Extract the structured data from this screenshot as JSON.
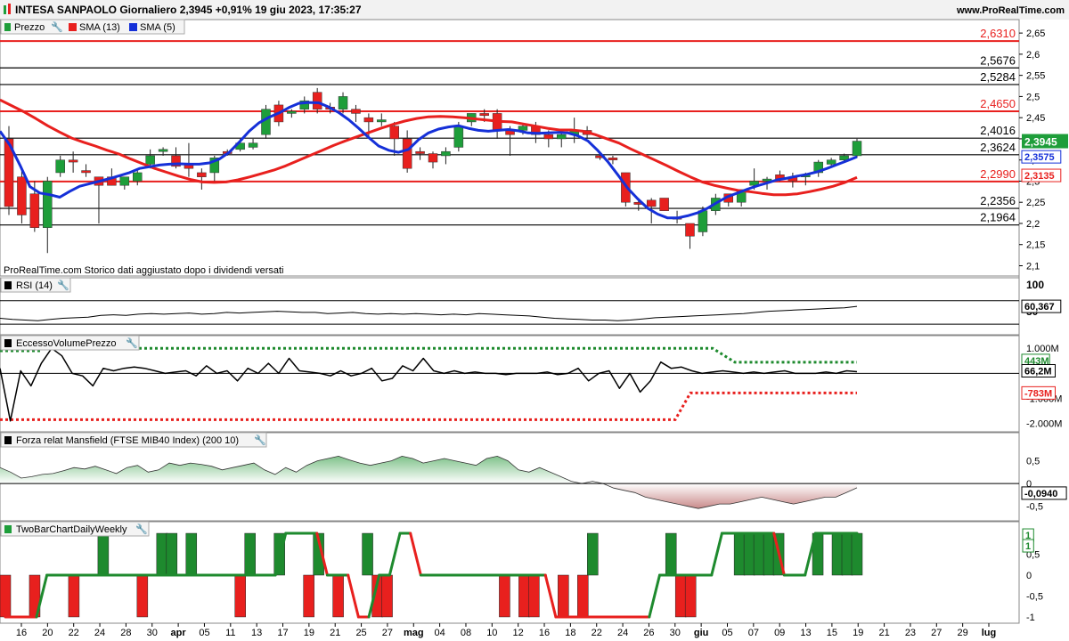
{
  "header": {
    "title": "INTESA SANPAOLO Giornaliero 2,3945 +0,91% 19 giu 2023, 17:35:27",
    "site": "www.ProRealTime.com"
  },
  "price_panel": {
    "legend": [
      {
        "label": "Prezzo",
        "color": "#1e9e3a"
      },
      {
        "label": "SMA (13)",
        "color": "#e8201e"
      },
      {
        "label": "SMA (5)",
        "color": "#1530d8"
      }
    ],
    "note": "ProRealTime.com  Storico dati aggiustato dopo i dividendi versati",
    "last_price_badge": "2,3945",
    "sma5_badge": "2,3575",
    "sma13_badge": "2,3135"
  },
  "rsi_panel": {
    "legend": "RSI (14)",
    "value_badge": "60,367",
    "ticks": [
      "100",
      "50"
    ]
  },
  "volume_panel": {
    "legend": "EccessoVolumePrezzo",
    "ticks": [
      "1.000M",
      "0",
      "-1.000M",
      "-2.000M"
    ],
    "badges": [
      "443M",
      "66,2M",
      "-783M"
    ]
  },
  "mansfield_panel": {
    "legend": "Forza relat Mansfield (FTSE MIB40 Index) (200 10)",
    "ticks": [
      "0,5",
      "0",
      "-0,5"
    ],
    "value_badge": "-0,0940"
  },
  "twobar_panel": {
    "legend": "TwoBarChartDailyWeekly",
    "ticks": [
      "1",
      "0,5",
      "0",
      "-0,5",
      "-1"
    ],
    "badges": [
      "1",
      "1"
    ]
  },
  "x_axis_labels": [
    "16",
    "20",
    "22",
    "24",
    "28",
    "30",
    "apr",
    "05",
    "11",
    "13",
    "17",
    "19",
    "21",
    "25",
    "27",
    "mag",
    "04",
    "08",
    "10",
    "12",
    "16",
    "18",
    "22",
    "24",
    "26",
    "30",
    "giu",
    "05",
    "07",
    "09",
    "13",
    "15",
    "19",
    "21",
    "23",
    "27",
    "29",
    "lug"
  ],
  "colors": {
    "up": "#1e9e3a",
    "down": "#e8201e",
    "sma13": "#e8201e",
    "sma5": "#1530d8",
    "grid": "#000000"
  },
  "chart_data": [
    {
      "type": "candlestick",
      "name": "Prezzo",
      "y_ticks": [
        "2,65",
        "2,6",
        "2,55",
        "2,5",
        "2,45",
        "2,4",
        "2,35",
        "2,3",
        "2,25",
        "2,2",
        "2,15",
        "2,1"
      ],
      "ylim": [
        2.08,
        2.665
      ],
      "horizontal_levels": [
        {
          "label": "2,6310",
          "value": 2.631,
          "color": "#e8201e"
        },
        {
          "label": "2,5676",
          "value": 2.5676,
          "color": "#000000"
        },
        {
          "label": "2,5284",
          "value": 2.5284,
          "color": "#000000"
        },
        {
          "label": "2,4650",
          "value": 2.465,
          "color": "#e8201e"
        },
        {
          "label": "2,4016",
          "value": 2.4016,
          "color": "#000000"
        },
        {
          "label": "2,3624",
          "value": 2.3624,
          "color": "#000000"
        },
        {
          "label": "2,2990",
          "value": 2.299,
          "color": "#e8201e"
        },
        {
          "label": "2,2356",
          "value": 2.2356,
          "color": "#000000"
        },
        {
          "label": "2,1964",
          "value": 2.1964,
          "color": "#000000"
        }
      ],
      "candles": [
        {
          "o": 2.4,
          "h": 2.43,
          "l": 2.22,
          "c": 2.24
        },
        {
          "o": 2.31,
          "h": 2.33,
          "l": 2.2,
          "c": 2.22
        },
        {
          "o": 2.27,
          "h": 2.3,
          "l": 2.18,
          "c": 2.19
        },
        {
          "o": 2.19,
          "h": 2.31,
          "l": 2.13,
          "c": 2.3
        },
        {
          "o": 2.32,
          "h": 2.36,
          "l": 2.31,
          "c": 2.35
        },
        {
          "o": 2.35,
          "h": 2.37,
          "l": 2.32,
          "c": 2.345
        },
        {
          "o": 2.325,
          "h": 2.34,
          "l": 2.31,
          "c": 2.32
        },
        {
          "o": 2.31,
          "h": 2.31,
          "l": 2.2,
          "c": 2.29
        },
        {
          "o": 2.31,
          "h": 2.33,
          "l": 2.29,
          "c": 2.29
        },
        {
          "o": 2.29,
          "h": 2.31,
          "l": 2.28,
          "c": 2.31
        },
        {
          "o": 2.3,
          "h": 2.33,
          "l": 2.29,
          "c": 2.32
        },
        {
          "o": 2.34,
          "h": 2.375,
          "l": 2.33,
          "c": 2.36
        },
        {
          "o": 2.37,
          "h": 2.38,
          "l": 2.36,
          "c": 2.375
        },
        {
          "o": 2.36,
          "h": 2.38,
          "l": 2.33,
          "c": 2.335
        },
        {
          "o": 2.34,
          "h": 2.39,
          "l": 2.31,
          "c": 2.33
        },
        {
          "o": 2.32,
          "h": 2.33,
          "l": 2.28,
          "c": 2.31
        },
        {
          "o": 2.32,
          "h": 2.36,
          "l": 2.3,
          "c": 2.355
        },
        {
          "o": 2.37,
          "h": 2.375,
          "l": 2.36,
          "c": 2.365
        },
        {
          "o": 2.375,
          "h": 2.4,
          "l": 2.37,
          "c": 2.39
        },
        {
          "o": 2.38,
          "h": 2.4,
          "l": 2.375,
          "c": 2.39
        },
        {
          "o": 2.41,
          "h": 2.48,
          "l": 2.4,
          "c": 2.47
        },
        {
          "o": 2.48,
          "h": 2.49,
          "l": 2.43,
          "c": 2.44
        },
        {
          "o": 2.46,
          "h": 2.47,
          "l": 2.45,
          "c": 2.465
        },
        {
          "o": 2.47,
          "h": 2.5,
          "l": 2.46,
          "c": 2.49
        },
        {
          "o": 2.51,
          "h": 2.52,
          "l": 2.46,
          "c": 2.47
        },
        {
          "o": 2.475,
          "h": 2.485,
          "l": 2.46,
          "c": 2.47
        },
        {
          "o": 2.47,
          "h": 2.51,
          "l": 2.46,
          "c": 2.5
        },
        {
          "o": 2.47,
          "h": 2.48,
          "l": 2.44,
          "c": 2.46
        },
        {
          "o": 2.45,
          "h": 2.46,
          "l": 2.4,
          "c": 2.44
        },
        {
          "o": 2.44,
          "h": 2.46,
          "l": 2.43,
          "c": 2.445
        },
        {
          "o": 2.43,
          "h": 2.44,
          "l": 2.36,
          "c": 2.4
        },
        {
          "o": 2.4,
          "h": 2.42,
          "l": 2.32,
          "c": 2.33
        },
        {
          "o": 2.37,
          "h": 2.38,
          "l": 2.35,
          "c": 2.365
        },
        {
          "o": 2.365,
          "h": 2.37,
          "l": 2.33,
          "c": 2.345
        },
        {
          "o": 2.36,
          "h": 2.38,
          "l": 2.34,
          "c": 2.37
        },
        {
          "o": 2.38,
          "h": 2.44,
          "l": 2.37,
          "c": 2.43
        },
        {
          "o": 2.44,
          "h": 2.46,
          "l": 2.43,
          "c": 2.46
        },
        {
          "o": 2.46,
          "h": 2.47,
          "l": 2.44,
          "c": 2.455
        },
        {
          "o": 2.46,
          "h": 2.47,
          "l": 2.4,
          "c": 2.42
        },
        {
          "o": 2.42,
          "h": 2.43,
          "l": 2.36,
          "c": 2.41
        },
        {
          "o": 2.42,
          "h": 2.435,
          "l": 2.41,
          "c": 2.43
        },
        {
          "o": 2.43,
          "h": 2.44,
          "l": 2.39,
          "c": 2.41
        },
        {
          "o": 2.41,
          "h": 2.42,
          "l": 2.38,
          "c": 2.4
        },
        {
          "o": 2.4,
          "h": 2.42,
          "l": 2.38,
          "c": 2.41
        },
        {
          "o": 2.41,
          "h": 2.45,
          "l": 2.39,
          "c": 2.42
        },
        {
          "o": 2.42,
          "h": 2.43,
          "l": 2.4,
          "c": 2.41
        },
        {
          "o": 2.36,
          "h": 2.37,
          "l": 2.35,
          "c": 2.355
        },
        {
          "o": 2.355,
          "h": 2.36,
          "l": 2.34,
          "c": 2.35
        },
        {
          "o": 2.32,
          "h": 2.32,
          "l": 2.24,
          "c": 2.25
        },
        {
          "o": 2.25,
          "h": 2.26,
          "l": 2.23,
          "c": 2.245
        },
        {
          "o": 2.255,
          "h": 2.26,
          "l": 2.2,
          "c": 2.24
        },
        {
          "o": 2.26,
          "h": 2.26,
          "l": 2.23,
          "c": 2.23
        },
        {
          "o": 2.215,
          "h": 2.23,
          "l": 2.2,
          "c": 2.21
        },
        {
          "o": 2.2,
          "h": 2.2,
          "l": 2.14,
          "c": 2.17
        },
        {
          "o": 2.18,
          "h": 2.24,
          "l": 2.17,
          "c": 2.23
        },
        {
          "o": 2.23,
          "h": 2.27,
          "l": 2.22,
          "c": 2.26
        },
        {
          "o": 2.27,
          "h": 2.27,
          "l": 2.24,
          "c": 2.25
        },
        {
          "o": 2.25,
          "h": 2.28,
          "l": 2.24,
          "c": 2.28
        },
        {
          "o": 2.29,
          "h": 2.33,
          "l": 2.28,
          "c": 2.3
        },
        {
          "o": 2.3,
          "h": 2.31,
          "l": 2.28,
          "c": 2.305
        },
        {
          "o": 2.315,
          "h": 2.325,
          "l": 2.3,
          "c": 2.305
        },
        {
          "o": 2.31,
          "h": 2.32,
          "l": 2.285,
          "c": 2.3
        },
        {
          "o": 2.31,
          "h": 2.32,
          "l": 2.29,
          "c": 2.315
        },
        {
          "o": 2.32,
          "h": 2.35,
          "l": 2.31,
          "c": 2.345
        },
        {
          "o": 2.34,
          "h": 2.355,
          "l": 2.335,
          "c": 2.35
        },
        {
          "o": 2.35,
          "h": 2.365,
          "l": 2.345,
          "c": 2.36
        },
        {
          "o": 2.36,
          "h": 2.4,
          "l": 2.355,
          "c": 2.3945
        }
      ],
      "sma13": [
        2.492,
        2.478,
        2.464,
        2.448,
        2.431,
        2.416,
        2.402,
        2.392,
        2.383,
        2.373,
        2.364,
        2.352,
        2.341,
        2.33,
        2.321,
        2.312,
        2.304,
        2.298,
        2.297,
        2.298,
        2.303,
        2.31,
        2.318,
        2.326,
        2.336,
        2.348,
        2.36,
        2.372,
        2.384,
        2.395,
        2.405,
        2.415,
        2.425,
        2.434,
        2.442,
        2.448,
        2.452,
        2.453,
        2.452,
        2.45,
        2.447,
        2.444,
        2.441,
        2.44,
        2.435,
        2.43,
        2.425,
        2.421,
        2.421,
        2.418,
        2.41,
        2.4,
        2.39,
        2.376,
        2.363,
        2.35,
        2.337,
        2.323,
        2.31,
        2.298,
        2.29,
        2.284,
        2.278,
        2.275,
        2.271,
        2.268,
        2.268,
        2.27,
        2.275,
        2.281,
        2.288,
        2.297,
        2.309
      ],
      "sma5": [
        2.418,
        2.385,
        2.338,
        2.287,
        2.272,
        2.268,
        2.262,
        2.276,
        2.288,
        2.294,
        2.3,
        2.306,
        2.313,
        2.32,
        2.33,
        2.334,
        2.338,
        2.34,
        2.341,
        2.34,
        2.34,
        2.343,
        2.352,
        2.368,
        2.392,
        2.418,
        2.438,
        2.451,
        2.461,
        2.474,
        2.484,
        2.486,
        2.485,
        2.475,
        2.462,
        2.445,
        2.425,
        2.403,
        2.383,
        2.373,
        2.368,
        2.375,
        2.398,
        2.414,
        2.423,
        2.428,
        2.431,
        2.425,
        2.42,
        2.418,
        2.42,
        2.422,
        2.419,
        2.414,
        2.413,
        2.414,
        2.415,
        2.414,
        2.407,
        2.395,
        2.372,
        2.346,
        2.315,
        2.283,
        2.258,
        2.236,
        2.222,
        2.213,
        2.213,
        2.218,
        2.225,
        2.236,
        2.25,
        2.263,
        2.272,
        2.281,
        2.289,
        2.296,
        2.303,
        2.307,
        2.312,
        2.316,
        2.322,
        2.33,
        2.339,
        2.348,
        2.3575
      ]
    },
    {
      "type": "line",
      "name": "RSI (14)",
      "ylim": [
        0,
        100
      ],
      "values": [
        40,
        38,
        37,
        36,
        38,
        40,
        41,
        42,
        45,
        46,
        45,
        47,
        48,
        47,
        48,
        49,
        47,
        48,
        50,
        49,
        50,
        51,
        52,
        51,
        50,
        50,
        48,
        49,
        50,
        48,
        47,
        48,
        47,
        48,
        47,
        46,
        47,
        46,
        48,
        47,
        46,
        45,
        44,
        42,
        40,
        39,
        38,
        37,
        37,
        36,
        37,
        39,
        41,
        42,
        43,
        44,
        45,
        46,
        47,
        48,
        50,
        52,
        53,
        54,
        55,
        56,
        57,
        58,
        60.367
      ]
    },
    {
      "type": "line",
      "name": "EccessoVolumePrezzo",
      "ylim": [
        -2.3,
        1.4
      ],
      "values": [
        0.2,
        -1.9,
        0.1,
        -0.5,
        0.4,
        1.0,
        0.7,
        0.0,
        -0.1,
        -0.5,
        0.2,
        0.1,
        0.2,
        0.25,
        0.2,
        0.1,
        0.0,
        0.05,
        0.1,
        -0.1,
        0.3,
        0.0,
        0.1,
        -0.3,
        0.2,
        0.0,
        0.4,
        0.0,
        0.6,
        0.1,
        0.05,
        0.0,
        -0.1,
        0.1,
        -0.1,
        0.0,
        0.2,
        -0.3,
        -0.2,
        0.3,
        0.1,
        0.6,
        0.1,
        0.0,
        0.1,
        0.0,
        0.05,
        0.0,
        0.0,
        -0.05,
        0.0,
        0.0,
        0.0,
        0.05,
        -0.05,
        0.0,
        0.2,
        -0.3,
        0.0,
        0.1,
        -0.6,
        0.0,
        -0.75,
        -0.3,
        0.45,
        0.2,
        0.25,
        0.1,
        0.0,
        0.05,
        0.1,
        0.05,
        0.0,
        0.05,
        0.0,
        0.05,
        0.1,
        0.0,
        0.0,
        0.0,
        0.05,
        0.0,
        0.1,
        0.066
      ],
      "upper_dotted": {
        "from": 1.0,
        "to": 0.443
      },
      "lower_dotted": {
        "from": -1.85,
        "to": -0.783
      }
    },
    {
      "type": "area",
      "name": "Forza relat Mansfield (FTSE MIB40 Index) (200 10)",
      "ylim": [
        -0.8,
        1.0
      ],
      "values": [
        0.35,
        0.25,
        0.12,
        0.15,
        0.2,
        0.22,
        0.28,
        0.35,
        0.32,
        0.38,
        0.3,
        0.22,
        0.35,
        0.4,
        0.25,
        0.3,
        0.45,
        0.4,
        0.45,
        0.42,
        0.38,
        0.3,
        0.35,
        0.4,
        0.45,
        0.3,
        0.2,
        0.35,
        0.25,
        0.4,
        0.5,
        0.55,
        0.6,
        0.52,
        0.45,
        0.4,
        0.45,
        0.5,
        0.6,
        0.55,
        0.45,
        0.5,
        0.55,
        0.5,
        0.45,
        0.4,
        0.55,
        0.6,
        0.5,
        0.3,
        0.25,
        0.35,
        0.25,
        0.15,
        0.05,
        0.0,
        0.05,
        0.0,
        -0.1,
        -0.15,
        -0.2,
        -0.3,
        -0.35,
        -0.4,
        -0.45,
        -0.5,
        -0.55,
        -0.5,
        -0.45,
        -0.45,
        -0.4,
        -0.35,
        -0.3,
        -0.35,
        -0.4,
        -0.45,
        -0.4,
        -0.35,
        -0.3,
        -0.3,
        -0.2,
        -0.094
      ]
    },
    {
      "type": "bar",
      "name": "TwoBarChartDailyWeekly",
      "ylim": [
        -1.15,
        1.15
      ],
      "values": [
        -1,
        0,
        0,
        -1,
        0,
        0,
        0,
        -1,
        0,
        0,
        1,
        0,
        0,
        0,
        -1,
        0,
        1,
        1,
        0,
        1,
        0,
        0,
        0,
        0,
        -1,
        1,
        0,
        0,
        1,
        0,
        0,
        -1,
        1,
        0,
        -1,
        0,
        0,
        1,
        -1,
        -1,
        0,
        0,
        0,
        0,
        0,
        0,
        0,
        0,
        0,
        0,
        0,
        -1,
        0,
        -1,
        -1,
        0,
        0,
        -1,
        0,
        -1,
        1,
        0,
        0,
        0,
        0,
        0,
        0,
        0,
        1,
        -1,
        -1,
        0,
        0,
        0,
        0,
        1,
        1,
        1,
        1,
        1,
        0,
        0,
        0,
        1,
        0,
        1,
        1,
        1
      ],
      "line": [
        -1,
        -1,
        -1,
        -1,
        0,
        0,
        0,
        0,
        0,
        0,
        0,
        0,
        0,
        0,
        0,
        0,
        0,
        0,
        0,
        0,
        0,
        0,
        0,
        0,
        0,
        0,
        0,
        1,
        1,
        1,
        1,
        0,
        0,
        0,
        -1,
        -1,
        0,
        0,
        1,
        1,
        0,
        0,
        0,
        0,
        0,
        0,
        0,
        0,
        0,
        0,
        0,
        0,
        0,
        -1,
        -1,
        -1,
        -1,
        -1,
        -1,
        -1,
        -1,
        -1,
        -1,
        0,
        0,
        0,
        0,
        0,
        0,
        1,
        1,
        1,
        1,
        1,
        1,
        0,
        0,
        0,
        1,
        1,
        1,
        1,
        1
      ]
    }
  ]
}
